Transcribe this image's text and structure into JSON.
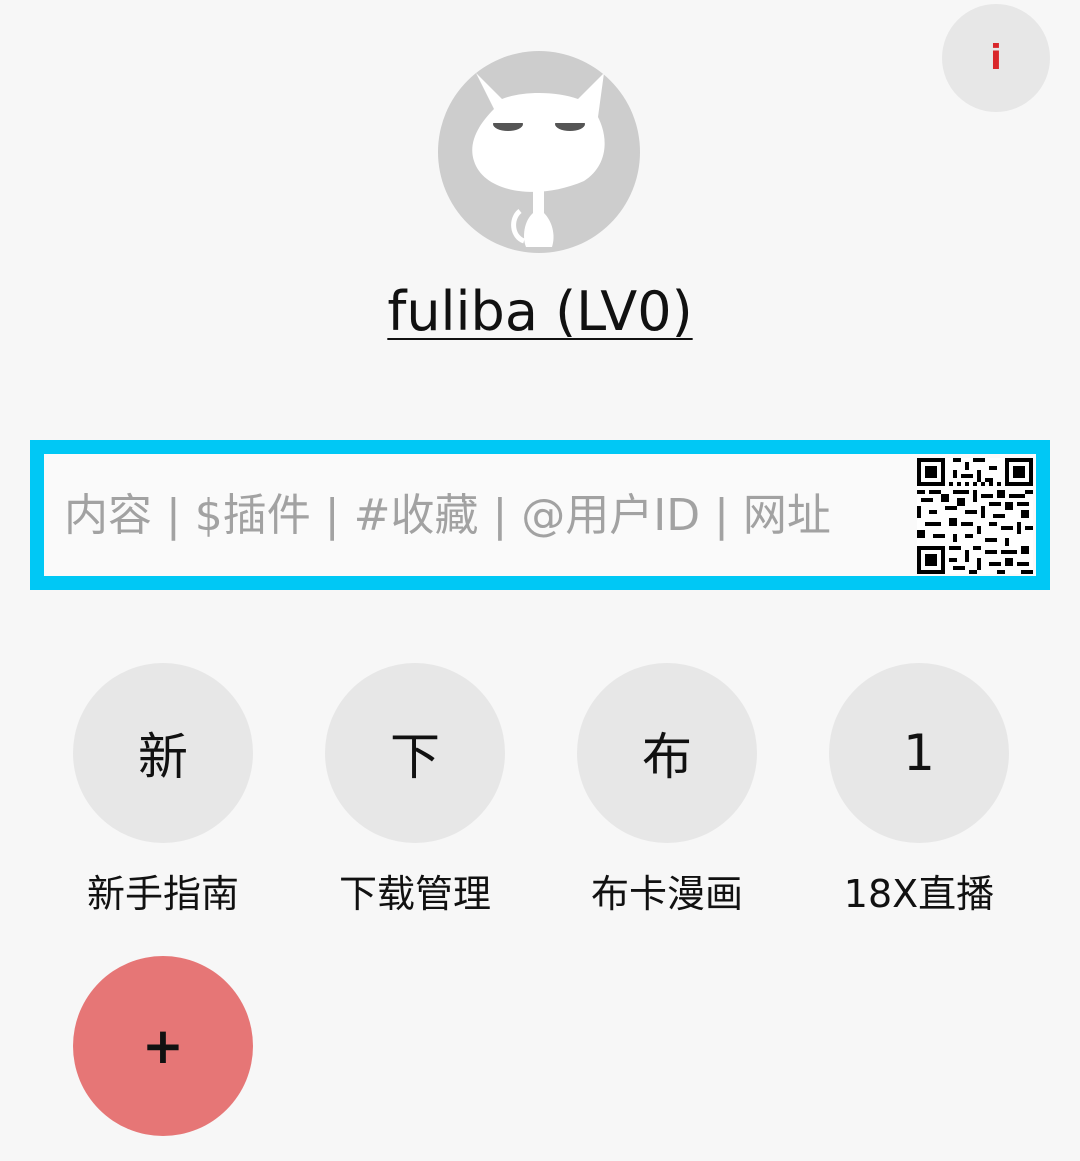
{
  "header": {
    "info_label": "i",
    "info_color": "#d9262a"
  },
  "profile": {
    "username": "fuliba (LV0)",
    "avatar_icon": "cat-avatar-icon"
  },
  "search": {
    "placeholder": "内容 | $插件 | #收藏 | @用户ID | 网址",
    "value": "",
    "border_color": "#00c8f5",
    "qr_icon": "qr-code-icon"
  },
  "shortcuts": [
    {
      "icon_text": "新",
      "label": "新手指南"
    },
    {
      "icon_text": "下",
      "label": "下载管理"
    },
    {
      "icon_text": "布",
      "label": "布卡漫画"
    },
    {
      "icon_text": "1",
      "label": "18X直播"
    }
  ],
  "add_button": {
    "label": "+",
    "color": "#e67676"
  }
}
